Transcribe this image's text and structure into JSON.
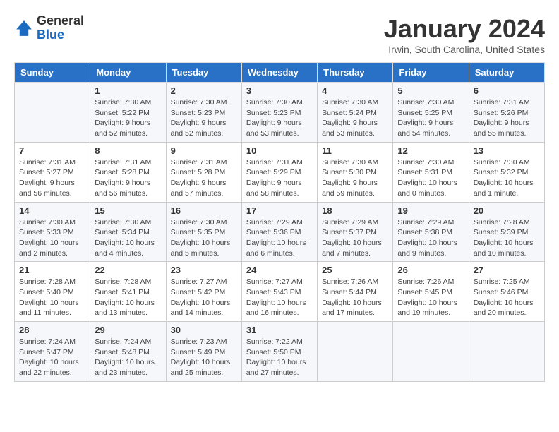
{
  "header": {
    "logo_general": "General",
    "logo_blue": "Blue",
    "month_title": "January 2024",
    "location": "Irwin, South Carolina, United States"
  },
  "days_of_week": [
    "Sunday",
    "Monday",
    "Tuesday",
    "Wednesday",
    "Thursday",
    "Friday",
    "Saturday"
  ],
  "weeks": [
    [
      {
        "day": "",
        "info": ""
      },
      {
        "day": "1",
        "info": "Sunrise: 7:30 AM\nSunset: 5:22 PM\nDaylight: 9 hours\nand 52 minutes."
      },
      {
        "day": "2",
        "info": "Sunrise: 7:30 AM\nSunset: 5:23 PM\nDaylight: 9 hours\nand 52 minutes."
      },
      {
        "day": "3",
        "info": "Sunrise: 7:30 AM\nSunset: 5:23 PM\nDaylight: 9 hours\nand 53 minutes."
      },
      {
        "day": "4",
        "info": "Sunrise: 7:30 AM\nSunset: 5:24 PM\nDaylight: 9 hours\nand 53 minutes."
      },
      {
        "day": "5",
        "info": "Sunrise: 7:30 AM\nSunset: 5:25 PM\nDaylight: 9 hours\nand 54 minutes."
      },
      {
        "day": "6",
        "info": "Sunrise: 7:31 AM\nSunset: 5:26 PM\nDaylight: 9 hours\nand 55 minutes."
      }
    ],
    [
      {
        "day": "7",
        "info": "Sunrise: 7:31 AM\nSunset: 5:27 PM\nDaylight: 9 hours\nand 56 minutes."
      },
      {
        "day": "8",
        "info": "Sunrise: 7:31 AM\nSunset: 5:28 PM\nDaylight: 9 hours\nand 56 minutes."
      },
      {
        "day": "9",
        "info": "Sunrise: 7:31 AM\nSunset: 5:28 PM\nDaylight: 9 hours\nand 57 minutes."
      },
      {
        "day": "10",
        "info": "Sunrise: 7:31 AM\nSunset: 5:29 PM\nDaylight: 9 hours\nand 58 minutes."
      },
      {
        "day": "11",
        "info": "Sunrise: 7:30 AM\nSunset: 5:30 PM\nDaylight: 9 hours\nand 59 minutes."
      },
      {
        "day": "12",
        "info": "Sunrise: 7:30 AM\nSunset: 5:31 PM\nDaylight: 10 hours\nand 0 minutes."
      },
      {
        "day": "13",
        "info": "Sunrise: 7:30 AM\nSunset: 5:32 PM\nDaylight: 10 hours\nand 1 minute."
      }
    ],
    [
      {
        "day": "14",
        "info": "Sunrise: 7:30 AM\nSunset: 5:33 PM\nDaylight: 10 hours\nand 2 minutes."
      },
      {
        "day": "15",
        "info": "Sunrise: 7:30 AM\nSunset: 5:34 PM\nDaylight: 10 hours\nand 4 minutes."
      },
      {
        "day": "16",
        "info": "Sunrise: 7:30 AM\nSunset: 5:35 PM\nDaylight: 10 hours\nand 5 minutes."
      },
      {
        "day": "17",
        "info": "Sunrise: 7:29 AM\nSunset: 5:36 PM\nDaylight: 10 hours\nand 6 minutes."
      },
      {
        "day": "18",
        "info": "Sunrise: 7:29 AM\nSunset: 5:37 PM\nDaylight: 10 hours\nand 7 minutes."
      },
      {
        "day": "19",
        "info": "Sunrise: 7:29 AM\nSunset: 5:38 PM\nDaylight: 10 hours\nand 9 minutes."
      },
      {
        "day": "20",
        "info": "Sunrise: 7:28 AM\nSunset: 5:39 PM\nDaylight: 10 hours\nand 10 minutes."
      }
    ],
    [
      {
        "day": "21",
        "info": "Sunrise: 7:28 AM\nSunset: 5:40 PM\nDaylight: 10 hours\nand 11 minutes."
      },
      {
        "day": "22",
        "info": "Sunrise: 7:28 AM\nSunset: 5:41 PM\nDaylight: 10 hours\nand 13 minutes."
      },
      {
        "day": "23",
        "info": "Sunrise: 7:27 AM\nSunset: 5:42 PM\nDaylight: 10 hours\nand 14 minutes."
      },
      {
        "day": "24",
        "info": "Sunrise: 7:27 AM\nSunset: 5:43 PM\nDaylight: 10 hours\nand 16 minutes."
      },
      {
        "day": "25",
        "info": "Sunrise: 7:26 AM\nSunset: 5:44 PM\nDaylight: 10 hours\nand 17 minutes."
      },
      {
        "day": "26",
        "info": "Sunrise: 7:26 AM\nSunset: 5:45 PM\nDaylight: 10 hours\nand 19 minutes."
      },
      {
        "day": "27",
        "info": "Sunrise: 7:25 AM\nSunset: 5:46 PM\nDaylight: 10 hours\nand 20 minutes."
      }
    ],
    [
      {
        "day": "28",
        "info": "Sunrise: 7:24 AM\nSunset: 5:47 PM\nDaylight: 10 hours\nand 22 minutes."
      },
      {
        "day": "29",
        "info": "Sunrise: 7:24 AM\nSunset: 5:48 PM\nDaylight: 10 hours\nand 23 minutes."
      },
      {
        "day": "30",
        "info": "Sunrise: 7:23 AM\nSunset: 5:49 PM\nDaylight: 10 hours\nand 25 minutes."
      },
      {
        "day": "31",
        "info": "Sunrise: 7:22 AM\nSunset: 5:50 PM\nDaylight: 10 hours\nand 27 minutes."
      },
      {
        "day": "",
        "info": ""
      },
      {
        "day": "",
        "info": ""
      },
      {
        "day": "",
        "info": ""
      }
    ]
  ]
}
